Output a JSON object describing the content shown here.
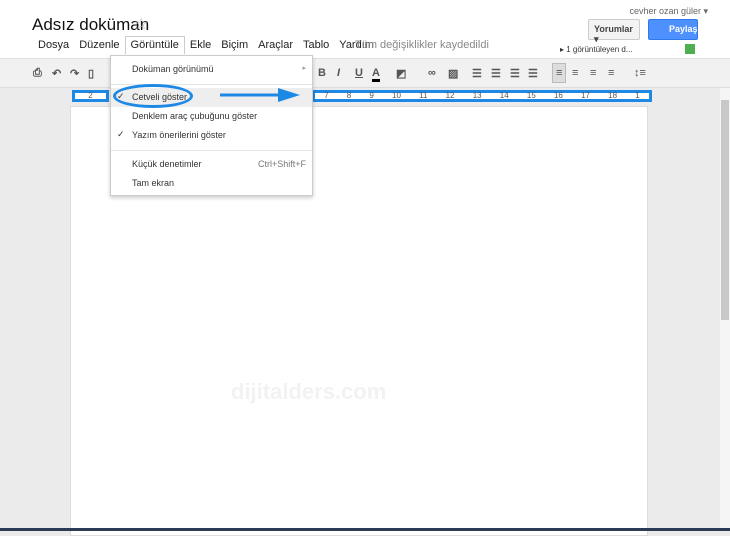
{
  "doc": {
    "title": "Adsız doküman",
    "saved_status": "Tüm değişiklikler kaydedildi",
    "watermark": "dijitalders.com"
  },
  "user": {
    "name": "cevher ozan güler ▾"
  },
  "buttons": {
    "comments": "Yorumlar ▾",
    "share": "Paylaş"
  },
  "viewers": "▸ 1 görüntüleyen d...",
  "menubar": [
    "Dosya",
    "Düzenle",
    "Görüntüle",
    "Ekle",
    "Biçim",
    "Araçlar",
    "Tablo",
    "Yardım"
  ],
  "toolbar": [
    "B",
    "I",
    "U",
    "A"
  ],
  "ruler": {
    "left": [
      "2"
    ],
    "right": [
      "7",
      "8",
      "9",
      "10",
      "11",
      "12",
      "13",
      "14",
      "15",
      "16",
      "17",
      "18",
      "1"
    ]
  },
  "view_menu": {
    "items": [
      {
        "label": "Doküman görünümü",
        "submenu": "▸"
      },
      {
        "label": "Cetveli göster",
        "checked": "✓"
      },
      {
        "label": "Denklem araç çubuğunu göster"
      },
      {
        "label": "Yazım önerilerini göster",
        "checked": "✓"
      },
      {
        "label": "Küçük denetimler",
        "shortcut": "Ctrl+Shift+F"
      },
      {
        "label": "Tam ekran"
      }
    ]
  },
  "colors": {
    "accent": "#1e88e5",
    "share": "#4d90fe"
  }
}
